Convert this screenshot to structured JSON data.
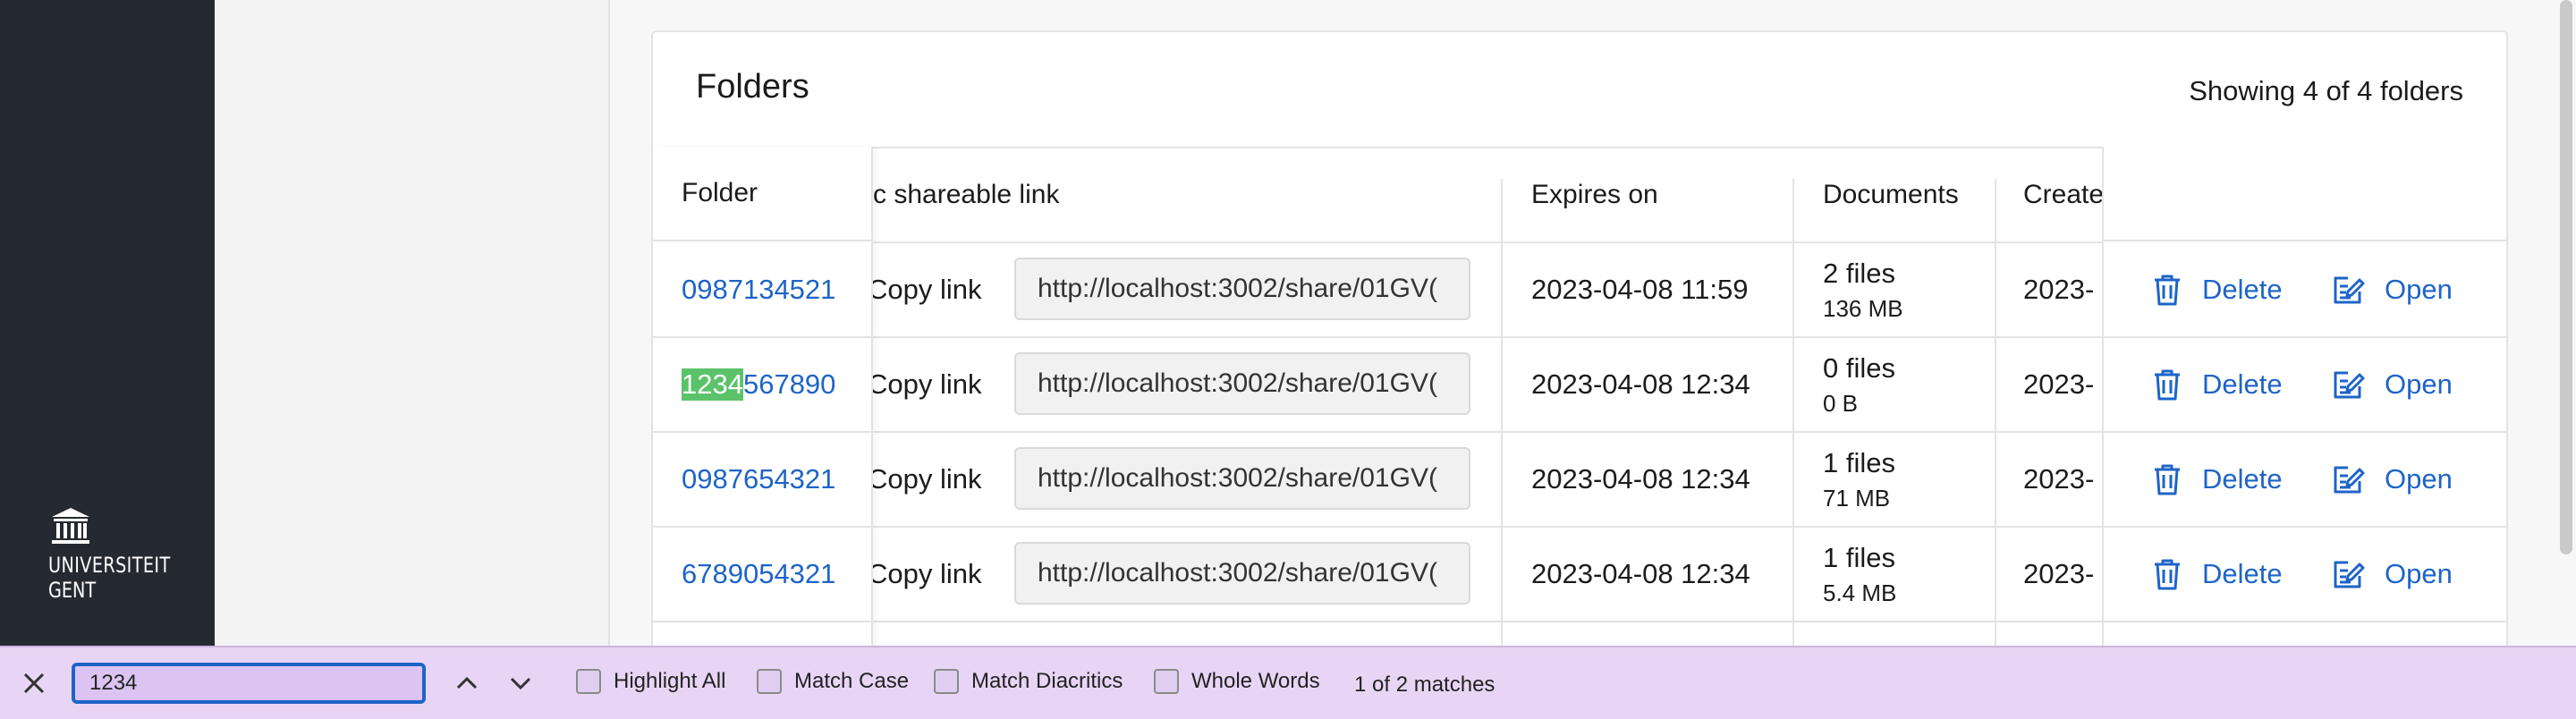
{
  "logo": {
    "line1": "UNIVERSITEIT",
    "line2": "GENT"
  },
  "card": {
    "title": "Folders",
    "count": "Showing 4 of 4 folders"
  },
  "columns": {
    "folder": "Folder",
    "link": "c shareable link",
    "expires": "Expires on",
    "documents": "Documents",
    "created": "Create"
  },
  "rows": [
    {
      "folder_pre": "",
      "folder_hl": "",
      "folder_rest": "0987134521",
      "copy": "Copy link",
      "url": "http://localhost:3002/share/01GV(",
      "expires": "2023-04-08 11:59",
      "files": "2 files",
      "size": "136 MB",
      "created": "2023-",
      "delete": "Delete",
      "open": "Open"
    },
    {
      "folder_pre": "",
      "folder_hl": "1234",
      "folder_rest": "567890",
      "copy": "Copy link",
      "url": "http://localhost:3002/share/01GV(",
      "expires": "2023-04-08 12:34",
      "files": "0 files",
      "size": "0 B",
      "created": "2023-",
      "delete": "Delete",
      "open": "Open"
    },
    {
      "folder_pre": "",
      "folder_hl": "",
      "folder_rest": "0987654321",
      "copy": "Copy link",
      "url": "http://localhost:3002/share/01GV(",
      "expires": "2023-04-08 12:34",
      "files": "1 files",
      "size": "71 MB",
      "created": "2023-",
      "delete": "Delete",
      "open": "Open"
    },
    {
      "folder_pre": "",
      "folder_hl": "",
      "folder_rest": "6789054321",
      "copy": "Copy link",
      "url": "http://localhost:3002/share/01GV(",
      "expires": "2023-04-08 12:34",
      "files": "1 files",
      "size": "5.4 MB",
      "created": "2023-",
      "delete": "Delete",
      "open": "Open"
    }
  ],
  "findbar": {
    "query": "1234",
    "highlight_all": "Highlight All",
    "match_case": "Match Case",
    "match_diacritics": "Match Diacritics",
    "whole_words": "Whole Words",
    "status": "1 of 2 matches"
  },
  "colors": {
    "link": "#1e64c8",
    "sidebar": "#252a31",
    "findbar": "#e8d5f5",
    "highlight": "#5bc26a"
  }
}
